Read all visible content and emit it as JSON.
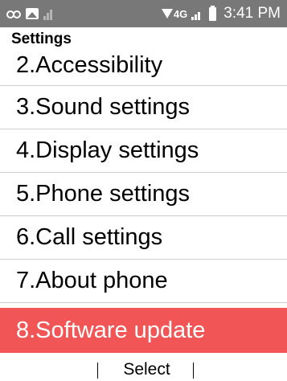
{
  "status_bar": {
    "time": "3:41 PM",
    "network": "4G",
    "icons": [
      "voicemail-icon",
      "image-icon",
      "signal-icon",
      "network-icon",
      "signal-icon",
      "battery-icon"
    ]
  },
  "header": {
    "title": "Settings"
  },
  "menu": {
    "items": [
      {
        "label": "2.Accessibility",
        "selected": false
      },
      {
        "label": "3.Sound settings",
        "selected": false
      },
      {
        "label": "4.Display settings",
        "selected": false
      },
      {
        "label": "5.Phone settings",
        "selected": false
      },
      {
        "label": "6.Call settings",
        "selected": false
      },
      {
        "label": "7.About phone",
        "selected": false
      },
      {
        "label": "8.Software update",
        "selected": true
      }
    ]
  },
  "softkeys": {
    "center": "Select"
  },
  "colors": {
    "status_bar": "#787878",
    "selection": "#f15555",
    "divider": "#cfcfcf"
  }
}
